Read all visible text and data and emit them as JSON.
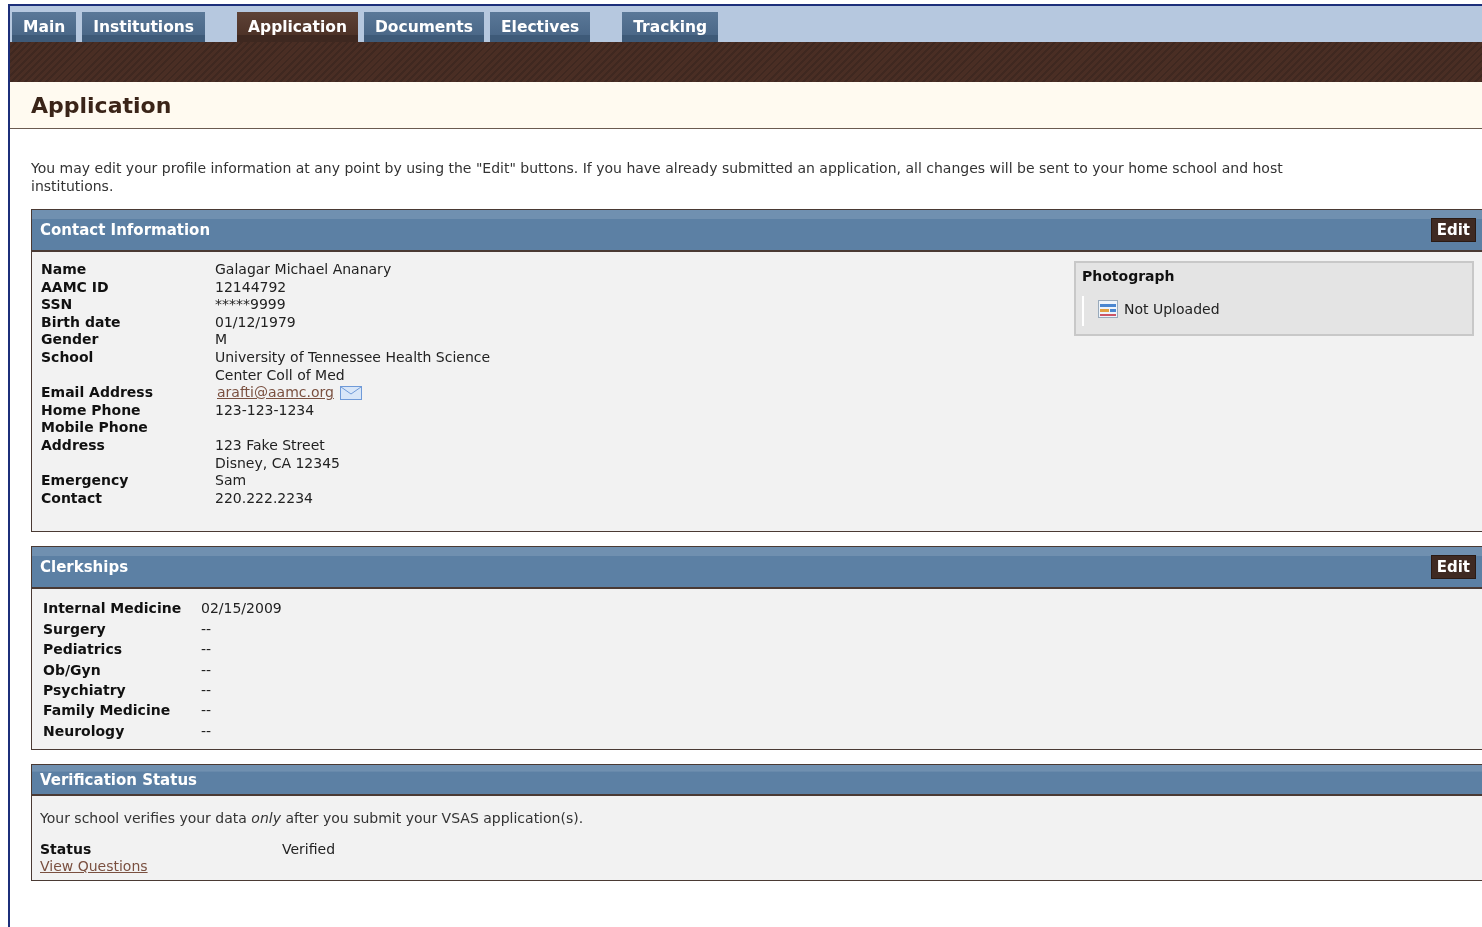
{
  "tab_groups": [
    [
      {
        "label": "Main",
        "selected": false
      },
      {
        "label": "Institutions",
        "selected": false
      }
    ],
    [
      {
        "label": "Application",
        "selected": true
      },
      {
        "label": "Documents",
        "selected": false
      },
      {
        "label": "Electives",
        "selected": false
      }
    ],
    [
      {
        "label": "Tracking",
        "selected": false
      }
    ]
  ],
  "page_title": "Application",
  "intro": "You may edit your profile information at any point by using the \"Edit\" buttons. If you have already submitted an application, all changes will be sent to your home school and host institutions.",
  "contact": {
    "title": "Contact Information",
    "edit_button": "Edit",
    "fields": [
      {
        "label": [
          "Name"
        ],
        "value": [
          "Galagar Michael Ananary"
        ],
        "kind": "text"
      },
      {
        "label": [
          "AAMC ID"
        ],
        "value": [
          "12144792"
        ],
        "kind": "text"
      },
      {
        "label": [
          "SSN"
        ],
        "value": [
          "*****9999"
        ],
        "kind": "text"
      },
      {
        "label": [
          "Birth date"
        ],
        "value": [
          "01/12/1979"
        ],
        "kind": "text"
      },
      {
        "label": [
          "Gender"
        ],
        "value": [
          "M"
        ],
        "kind": "text"
      },
      {
        "label": [
          "School"
        ],
        "value": [
          "University of Tennessee Health Science",
          "Center Coll of Med"
        ],
        "kind": "text"
      },
      {
        "label": [
          "Email Address"
        ],
        "value": [
          "arafti@aamc.org"
        ],
        "kind": "email"
      },
      {
        "label": [
          "Home Phone"
        ],
        "value": [
          "123-123-1234"
        ],
        "kind": "text"
      },
      {
        "label": [
          "Mobile Phone"
        ],
        "kind": "text"
      },
      {
        "label": [
          "Address"
        ],
        "value": [
          "123 Fake Street",
          "Disney, CA 12345"
        ],
        "kind": "text"
      },
      {
        "label": [
          "Emergency",
          "Contact"
        ],
        "value": [
          "Sam",
          "220.222.2234"
        ],
        "kind": "text"
      }
    ],
    "photograph": {
      "title": "Photograph",
      "status": "Not Uploaded"
    }
  },
  "clerkships": {
    "title": "Clerkships",
    "edit_button": "Edit",
    "rows": [
      {
        "name": "Internal Medicine",
        "date": "02/15/2009"
      },
      {
        "name": "Surgery",
        "date": "--"
      },
      {
        "name": "Pediatrics",
        "date": "--"
      },
      {
        "name": "Ob/Gyn",
        "date": "--"
      },
      {
        "name": "Psychiatry",
        "date": "--"
      },
      {
        "name": "Family Medicine",
        "date": "--"
      },
      {
        "name": "Neurology",
        "date": "--"
      }
    ]
  },
  "verification": {
    "title": "Verification Status",
    "note": "Your school verifies your data *only* after you submit your VSAS application(s).",
    "status_label": "Status",
    "status_value": "Verified",
    "link": "View Questions"
  }
}
